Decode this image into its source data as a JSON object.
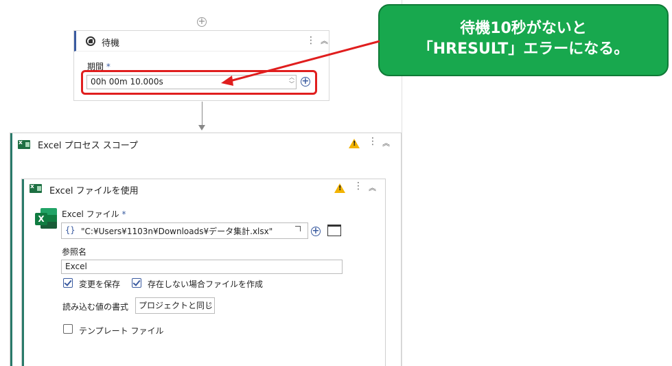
{
  "wait_activity": {
    "title": "待機",
    "duration_label": "期間",
    "required_mark": "*",
    "duration_value": "00h 00m 10.000s"
  },
  "excel_scope": {
    "title": "Excel プロセス スコープ"
  },
  "use_excel_file": {
    "title": "Excel ファイルを使用",
    "file_label": "Excel ファイル",
    "required_mark": "*",
    "braces": "{}",
    "file_path": "\"C:¥Users¥1103n¥Downloads¥データ集計.xlsx\"",
    "reference_label": "参照名",
    "reference_value": "Excel",
    "save_changes_label": "変更を保存",
    "save_changes_checked": true,
    "create_if_missing_label": "存在しない場合ファイルを作成",
    "create_if_missing_checked": true,
    "read_format_label": "読み込む値の書式",
    "read_format_value": "プロジェクトと同じ",
    "template_file_label": "テンプレート ファイル",
    "template_file_checked": false
  },
  "callout": {
    "line1": "待機10秒がないと",
    "line2": "「HRESULT」エラーになる。"
  },
  "colors": {
    "callout_bg": "#18a84e",
    "highlight_red": "#e01e1e",
    "accent_blue": "#3a5ba0",
    "excel_green": "#107c41",
    "warning": "#f2b300"
  }
}
